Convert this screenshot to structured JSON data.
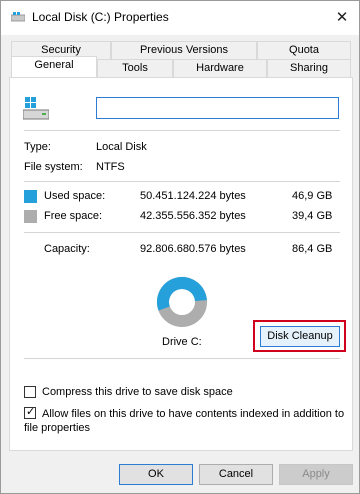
{
  "window": {
    "title": "Local Disk (C:) Properties",
    "close_label": "✕"
  },
  "tabs": {
    "row1": [
      "Security",
      "Previous Versions",
      "Quota"
    ],
    "row2": [
      "General",
      "Tools",
      "Hardware",
      "Sharing"
    ],
    "active": "General"
  },
  "general": {
    "name_value": "",
    "type_label": "Type:",
    "type_value": "Local Disk",
    "fs_label": "File system:",
    "fs_value": "NTFS",
    "used": {
      "label": "Used space:",
      "bytes": "50.451.124.224 bytes",
      "size": "46,9 GB",
      "color": "#26a0da",
      "fraction": 0.543
    },
    "free": {
      "label": "Free space:",
      "bytes": "42.355.556.352 bytes",
      "size": "39,4 GB",
      "color": "#adadad",
      "fraction": 0.457
    },
    "capacity": {
      "label": "Capacity:",
      "bytes": "92.806.680.576 bytes",
      "size": "86,4 GB"
    },
    "drive_label": "Drive C:",
    "cleanup_label": "Disk Cleanup",
    "highlight_color": "#d0021b"
  },
  "options": {
    "compress_label": "Compress this drive to save disk space",
    "compress_checked": false,
    "index_label_line1": "Allow files on this drive to have contents indexed in addition to",
    "index_label_line2": "file properties",
    "index_checked": true
  },
  "buttons": {
    "ok": "OK",
    "cancel": "Cancel",
    "apply": "Apply"
  }
}
